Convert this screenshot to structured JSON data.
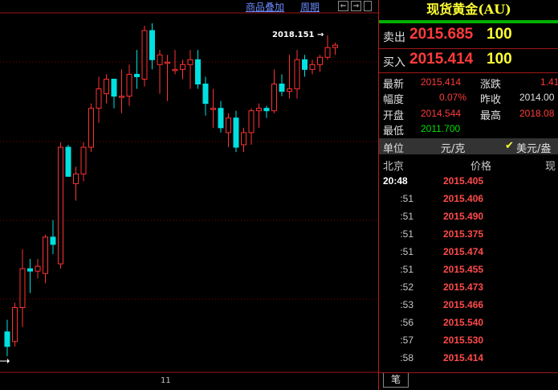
{
  "toolbar": {
    "overlay_label": "商品叠加",
    "period_label": "周期",
    "nav_left_label": "⇐",
    "nav_right_label": "⇒"
  },
  "chart": {
    "annotation_label": "2018.151",
    "annotation_arrow": "→",
    "x_tick_label": "11",
    "colors": {
      "up": "#ff3232",
      "down": "#00e0e0",
      "grid": "#8a0000",
      "axis": "#a01818"
    }
  },
  "chart_data": {
    "type": "candlestick",
    "candles": [
      {
        "o": 2012.2,
        "h": 2012.45,
        "l": 2011.7,
        "c": 2011.9
      },
      {
        "o": 2012.0,
        "h": 2012.8,
        "l": 2011.9,
        "c": 2012.7
      },
      {
        "o": 2012.7,
        "h": 2013.9,
        "l": 2012.3,
        "c": 2013.5
      },
      {
        "o": 2013.5,
        "h": 2013.7,
        "l": 2013.0,
        "c": 2013.45
      },
      {
        "o": 2013.45,
        "h": 2013.7,
        "l": 2013.3,
        "c": 2013.55
      },
      {
        "o": 2013.4,
        "h": 2014.2,
        "l": 2013.2,
        "c": 2014.15
      },
      {
        "o": 2014.15,
        "h": 2014.5,
        "l": 2013.8,
        "c": 2014.0
      },
      {
        "o": 2013.6,
        "h": 2016.1,
        "l": 2013.5,
        "c": 2016.0
      },
      {
        "o": 2016.0,
        "h": 2016.05,
        "l": 2015.4,
        "c": 2015.4
      },
      {
        "o": 2015.25,
        "h": 2015.6,
        "l": 2014.9,
        "c": 2015.45
      },
      {
        "o": 2015.45,
        "h": 2016.1,
        "l": 2015.3,
        "c": 2016.0
      },
      {
        "o": 2016.0,
        "h": 2016.9,
        "l": 2015.9,
        "c": 2016.8
      },
      {
        "o": 2016.8,
        "h": 2017.45,
        "l": 2016.5,
        "c": 2017.2
      },
      {
        "o": 2017.1,
        "h": 2017.5,
        "l": 2016.9,
        "c": 2017.4
      },
      {
        "o": 2017.4,
        "h": 2017.4,
        "l": 2016.8,
        "c": 2017.05
      },
      {
        "o": 2017.05,
        "h": 2017.6,
        "l": 2016.7,
        "c": 2017.05
      },
      {
        "o": 2017.05,
        "h": 2017.7,
        "l": 2016.85,
        "c": 2017.5
      },
      {
        "o": 2017.5,
        "h": 2018.0,
        "l": 2017.2,
        "c": 2017.45
      },
      {
        "o": 2017.4,
        "h": 2018.5,
        "l": 2017.25,
        "c": 2018.4
      },
      {
        "o": 2018.4,
        "h": 2018.55,
        "l": 2017.6,
        "c": 2017.8
      },
      {
        "o": 2017.7,
        "h": 2018.0,
        "l": 2017.1,
        "c": 2017.9
      },
      {
        "o": 2017.75,
        "h": 2017.9,
        "l": 2016.95,
        "c": 2017.75
      },
      {
        "o": 2017.6,
        "h": 2018.0,
        "l": 2017.5,
        "c": 2017.6
      },
      {
        "o": 2017.6,
        "h": 2017.8,
        "l": 2017.4,
        "c": 2017.7
      },
      {
        "o": 2017.7,
        "h": 2018.0,
        "l": 2017.2,
        "c": 2017.8
      },
      {
        "o": 2017.8,
        "h": 2018.0,
        "l": 2017.2,
        "c": 2017.3
      },
      {
        "o": 2017.3,
        "h": 2017.45,
        "l": 2016.65,
        "c": 2016.9
      },
      {
        "o": 2016.8,
        "h": 2017.2,
        "l": 2016.4,
        "c": 2016.8
      },
      {
        "o": 2016.8,
        "h": 2016.95,
        "l": 2016.3,
        "c": 2016.4
      },
      {
        "o": 2016.3,
        "h": 2016.7,
        "l": 2016.0,
        "c": 2016.6
      },
      {
        "o": 2016.6,
        "h": 2016.75,
        "l": 2015.9,
        "c": 2016.0
      },
      {
        "o": 2016.05,
        "h": 2016.4,
        "l": 2015.9,
        "c": 2016.3
      },
      {
        "o": 2016.3,
        "h": 2016.8,
        "l": 2016.05,
        "c": 2016.75
      },
      {
        "o": 2016.75,
        "h": 2016.9,
        "l": 2016.4,
        "c": 2016.8
      },
      {
        "o": 2016.8,
        "h": 2016.85,
        "l": 2016.6,
        "c": 2016.75
      },
      {
        "o": 2016.75,
        "h": 2017.6,
        "l": 2016.7,
        "c": 2017.3
      },
      {
        "o": 2017.3,
        "h": 2017.5,
        "l": 2017.05,
        "c": 2017.15
      },
      {
        "o": 2017.15,
        "h": 2017.9,
        "l": 2017.0,
        "c": 2017.2
      },
      {
        "o": 2017.2,
        "h": 2018.0,
        "l": 2017.0,
        "c": 2017.8
      },
      {
        "o": 2017.8,
        "h": 2017.9,
        "l": 2017.45,
        "c": 2017.6
      },
      {
        "o": 2017.6,
        "h": 2017.8,
        "l": 2017.5,
        "c": 2017.7
      },
      {
        "o": 2017.7,
        "h": 2017.9,
        "l": 2017.55,
        "c": 2017.85
      },
      {
        "o": 2017.85,
        "h": 2018.3,
        "l": 2017.8,
        "c": 2018.05
      },
      {
        "o": 2018.05,
        "h": 2018.15,
        "l": 2017.9,
        "c": 2018.1
      }
    ],
    "ylim": [
      2011.55,
      2018.4
    ],
    "max_label_value": 2018.151,
    "x_ticks": [
      "11"
    ],
    "grid": true
  },
  "panel": {
    "title": "现货黄金(AU)",
    "sell_label": "卖出",
    "sell_price": "2015.685",
    "sell_vol": "100",
    "buy_label": "买入",
    "buy_price": "2015.414",
    "buy_vol": "100",
    "stats": {
      "latest_label": "最新",
      "latest_value": "2015.414",
      "change_label": "涨跌",
      "change_value": "1.41",
      "amp_label": "幅度",
      "amp_value": "0.07%",
      "prev_label": "昨收",
      "prev_value": "2014.00",
      "open_label": "开盘",
      "open_value": "2014.544",
      "high_label": "最高",
      "high_value": "2018.08",
      "low_label": "最低",
      "low_value": "2011.700"
    },
    "unit_label": "单位",
    "unit_value": "元/克",
    "unit_checkbox_label": "美元/盎",
    "tick_header": {
      "time": "北京",
      "price": "价格",
      "vol": "现"
    },
    "ticks": [
      {
        "time": "20:48",
        "price": "2015.405"
      },
      {
        "time": ":51",
        "price": "2015.406"
      },
      {
        "time": ":51",
        "price": "2015.490"
      },
      {
        "time": ":51",
        "price": "2015.375"
      },
      {
        "time": ":51",
        "price": "2015.474"
      },
      {
        "time": ":51",
        "price": "2015.455"
      },
      {
        "time": ":52",
        "price": "2015.473"
      },
      {
        "time": ":53",
        "price": "2015.466"
      },
      {
        "time": ":56",
        "price": "2015.540"
      },
      {
        "time": ":57",
        "price": "2015.530"
      },
      {
        "time": ":58",
        "price": "2015.414"
      }
    ],
    "bottom_tab_label": "笔",
    "colors": {
      "title": "#ffff33",
      "up": "#ff3b3b",
      "green": "#00e000"
    }
  }
}
